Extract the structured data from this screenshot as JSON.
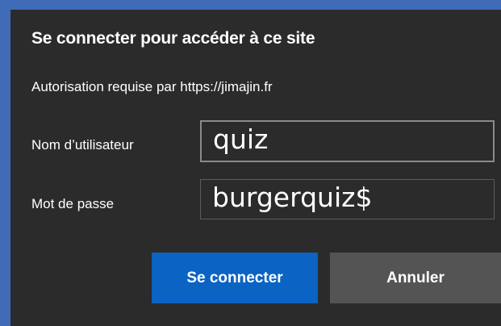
{
  "dialog": {
    "title": "Se connecter pour accéder à ce site",
    "subtitle": "Autorisation requise par https://jimajin.fr",
    "username_label": "Nom d’utilisateur",
    "username_value": "quiz",
    "password_label": "Mot de passe",
    "password_value": "burgerquiz$",
    "submit_label": "Se connecter",
    "cancel_label": "Annuler"
  },
  "colors": {
    "background": "#3f6bb7",
    "dialog": "#2b2b2b",
    "primary_button": "#0b63c4",
    "secondary_button": "#545454"
  }
}
